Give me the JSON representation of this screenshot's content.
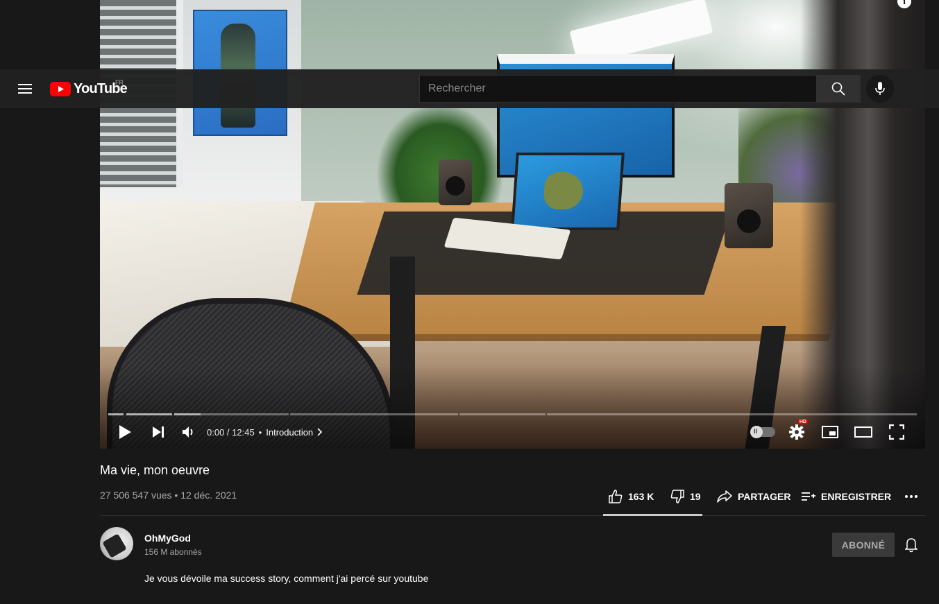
{
  "masthead": {
    "logo_text": "YouTube",
    "country_code": "FR",
    "search_placeholder": "Rechercher"
  },
  "player": {
    "time": "0:00 / 12:45",
    "chapter": "Introduction",
    "autoplay_state": "paused",
    "quality_badge": "HD"
  },
  "video": {
    "title": "Ma vie, mon oeuvre",
    "views": "27 506 547 vues",
    "date": "12 déc. 2021",
    "separator": "•"
  },
  "actions": {
    "likes": "163 K",
    "dislikes": "19",
    "share": "PARTAGER",
    "save": "ENREGISTRER"
  },
  "channel": {
    "name": "OhMyGod",
    "subscribers": "156 M abonnés",
    "subscribe_label": "ABONNÉ"
  },
  "description": "Je vous dévoile ma success story, comment j'ai percé sur youtube",
  "colors": {
    "brand_red": "#ff0000",
    "background": "#181818",
    "masthead": "#212121"
  }
}
